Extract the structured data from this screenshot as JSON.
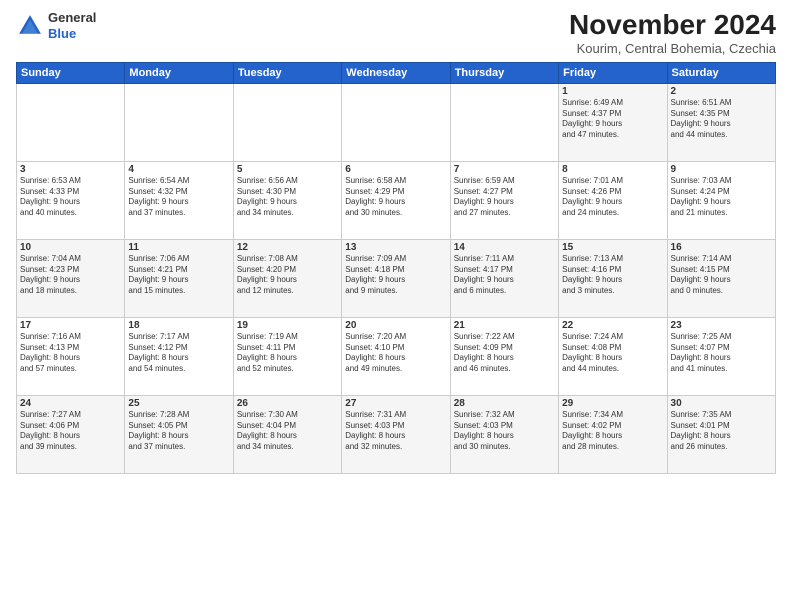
{
  "logo": {
    "general": "General",
    "blue": "Blue"
  },
  "title": "November 2024",
  "location": "Kourim, Central Bohemia, Czechia",
  "days_header": [
    "Sunday",
    "Monday",
    "Tuesday",
    "Wednesday",
    "Thursday",
    "Friday",
    "Saturday"
  ],
  "weeks": [
    [
      {
        "day": "",
        "info": ""
      },
      {
        "day": "",
        "info": ""
      },
      {
        "day": "",
        "info": ""
      },
      {
        "day": "",
        "info": ""
      },
      {
        "day": "",
        "info": ""
      },
      {
        "day": "1",
        "info": "Sunrise: 6:49 AM\nSunset: 4:37 PM\nDaylight: 9 hours\nand 47 minutes."
      },
      {
        "day": "2",
        "info": "Sunrise: 6:51 AM\nSunset: 4:35 PM\nDaylight: 9 hours\nand 44 minutes."
      }
    ],
    [
      {
        "day": "3",
        "info": "Sunrise: 6:53 AM\nSunset: 4:33 PM\nDaylight: 9 hours\nand 40 minutes."
      },
      {
        "day": "4",
        "info": "Sunrise: 6:54 AM\nSunset: 4:32 PM\nDaylight: 9 hours\nand 37 minutes."
      },
      {
        "day": "5",
        "info": "Sunrise: 6:56 AM\nSunset: 4:30 PM\nDaylight: 9 hours\nand 34 minutes."
      },
      {
        "day": "6",
        "info": "Sunrise: 6:58 AM\nSunset: 4:29 PM\nDaylight: 9 hours\nand 30 minutes."
      },
      {
        "day": "7",
        "info": "Sunrise: 6:59 AM\nSunset: 4:27 PM\nDaylight: 9 hours\nand 27 minutes."
      },
      {
        "day": "8",
        "info": "Sunrise: 7:01 AM\nSunset: 4:26 PM\nDaylight: 9 hours\nand 24 minutes."
      },
      {
        "day": "9",
        "info": "Sunrise: 7:03 AM\nSunset: 4:24 PM\nDaylight: 9 hours\nand 21 minutes."
      }
    ],
    [
      {
        "day": "10",
        "info": "Sunrise: 7:04 AM\nSunset: 4:23 PM\nDaylight: 9 hours\nand 18 minutes."
      },
      {
        "day": "11",
        "info": "Sunrise: 7:06 AM\nSunset: 4:21 PM\nDaylight: 9 hours\nand 15 minutes."
      },
      {
        "day": "12",
        "info": "Sunrise: 7:08 AM\nSunset: 4:20 PM\nDaylight: 9 hours\nand 12 minutes."
      },
      {
        "day": "13",
        "info": "Sunrise: 7:09 AM\nSunset: 4:18 PM\nDaylight: 9 hours\nand 9 minutes."
      },
      {
        "day": "14",
        "info": "Sunrise: 7:11 AM\nSunset: 4:17 PM\nDaylight: 9 hours\nand 6 minutes."
      },
      {
        "day": "15",
        "info": "Sunrise: 7:13 AM\nSunset: 4:16 PM\nDaylight: 9 hours\nand 3 minutes."
      },
      {
        "day": "16",
        "info": "Sunrise: 7:14 AM\nSunset: 4:15 PM\nDaylight: 9 hours\nand 0 minutes."
      }
    ],
    [
      {
        "day": "17",
        "info": "Sunrise: 7:16 AM\nSunset: 4:13 PM\nDaylight: 8 hours\nand 57 minutes."
      },
      {
        "day": "18",
        "info": "Sunrise: 7:17 AM\nSunset: 4:12 PM\nDaylight: 8 hours\nand 54 minutes."
      },
      {
        "day": "19",
        "info": "Sunrise: 7:19 AM\nSunset: 4:11 PM\nDaylight: 8 hours\nand 52 minutes."
      },
      {
        "day": "20",
        "info": "Sunrise: 7:20 AM\nSunset: 4:10 PM\nDaylight: 8 hours\nand 49 minutes."
      },
      {
        "day": "21",
        "info": "Sunrise: 7:22 AM\nSunset: 4:09 PM\nDaylight: 8 hours\nand 46 minutes."
      },
      {
        "day": "22",
        "info": "Sunrise: 7:24 AM\nSunset: 4:08 PM\nDaylight: 8 hours\nand 44 minutes."
      },
      {
        "day": "23",
        "info": "Sunrise: 7:25 AM\nSunset: 4:07 PM\nDaylight: 8 hours\nand 41 minutes."
      }
    ],
    [
      {
        "day": "24",
        "info": "Sunrise: 7:27 AM\nSunset: 4:06 PM\nDaylight: 8 hours\nand 39 minutes."
      },
      {
        "day": "25",
        "info": "Sunrise: 7:28 AM\nSunset: 4:05 PM\nDaylight: 8 hours\nand 37 minutes."
      },
      {
        "day": "26",
        "info": "Sunrise: 7:30 AM\nSunset: 4:04 PM\nDaylight: 8 hours\nand 34 minutes."
      },
      {
        "day": "27",
        "info": "Sunrise: 7:31 AM\nSunset: 4:03 PM\nDaylight: 8 hours\nand 32 minutes."
      },
      {
        "day": "28",
        "info": "Sunrise: 7:32 AM\nSunset: 4:03 PM\nDaylight: 8 hours\nand 30 minutes."
      },
      {
        "day": "29",
        "info": "Sunrise: 7:34 AM\nSunset: 4:02 PM\nDaylight: 8 hours\nand 28 minutes."
      },
      {
        "day": "30",
        "info": "Sunrise: 7:35 AM\nSunset: 4:01 PM\nDaylight: 8 hours\nand 26 minutes."
      }
    ]
  ]
}
